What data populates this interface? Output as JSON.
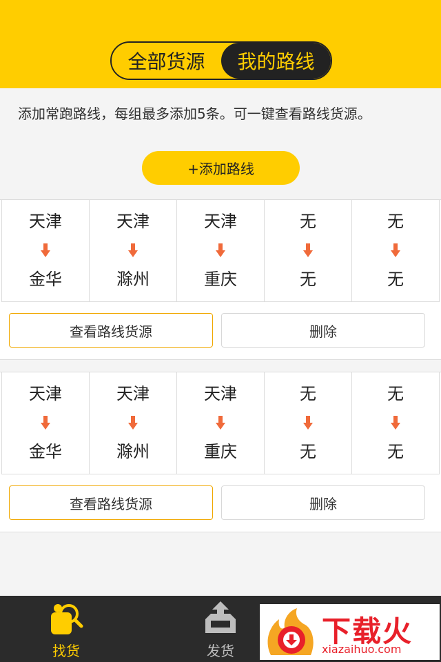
{
  "header": {
    "tabs": [
      {
        "label": "全部货源",
        "active": false
      },
      {
        "label": "我的路线",
        "active": true
      }
    ]
  },
  "hint": "添加常跑路线，每组最多添加5条。可一键查看路线货源。",
  "add_button": "+添加路线",
  "groups": [
    {
      "routes": [
        {
          "from": "天津",
          "to": "金华"
        },
        {
          "from": "天津",
          "to": "滁州"
        },
        {
          "from": "天津",
          "to": "重庆"
        },
        {
          "from": "无",
          "to": "无"
        },
        {
          "from": "无",
          "to": "无"
        }
      ],
      "view_label": "查看路线货源",
      "delete_label": "删除"
    },
    {
      "routes": [
        {
          "from": "天津",
          "to": "金华"
        },
        {
          "from": "天津",
          "to": "滁州"
        },
        {
          "from": "天津",
          "to": "重庆"
        },
        {
          "from": "无",
          "to": "无"
        },
        {
          "from": "无",
          "to": "无"
        }
      ],
      "view_label": "查看路线货源",
      "delete_label": "删除"
    }
  ],
  "tabbar": {
    "find_label": "找货",
    "send_label": "发货",
    "find_icon": "search-goods-icon",
    "send_icon": "send-box-icon"
  },
  "watermark": {
    "text": "下载火",
    "url": "xiazaihuo.com"
  },
  "colors": {
    "brand": "#ffcd00",
    "arrow": "#f06a3a",
    "tabbar": "#2b2b2b"
  }
}
